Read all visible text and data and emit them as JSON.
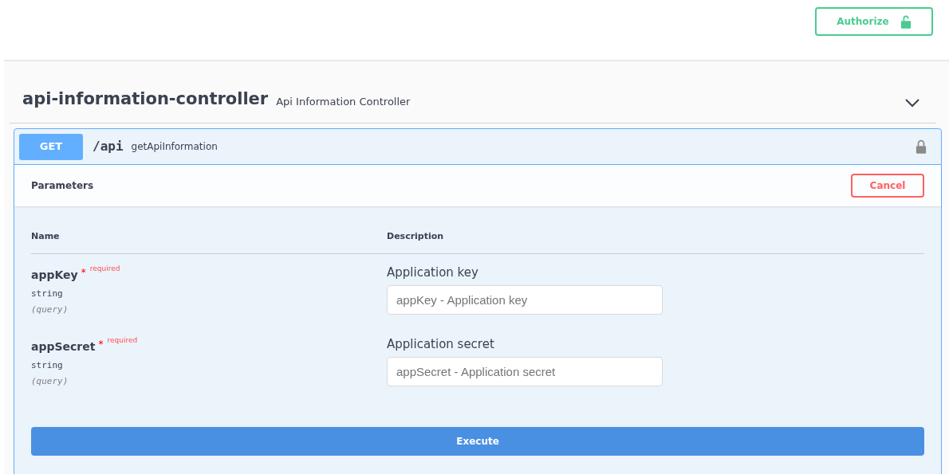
{
  "authorize": {
    "label": "Authorize"
  },
  "tag": {
    "name": "api-information-controller",
    "description": "Api Information Controller"
  },
  "operation": {
    "method": "GET",
    "path": "/api",
    "summary": "getApiInformation"
  },
  "parameters": {
    "title": "Parameters",
    "cancel": "Cancel",
    "columns": [
      "Name",
      "Description"
    ],
    "rows": [
      {
        "name": "appKey",
        "required_mark": "*",
        "required_label": "required",
        "type": "string",
        "location": "(query)",
        "description": "Application key",
        "placeholder": "appKey - Application key"
      },
      {
        "name": "appSecret",
        "required_mark": "*",
        "required_label": "required",
        "type": "string",
        "location": "(query)",
        "description": "Application secret",
        "placeholder": "appSecret - Application secret"
      }
    ]
  },
  "execute": "Execute"
}
